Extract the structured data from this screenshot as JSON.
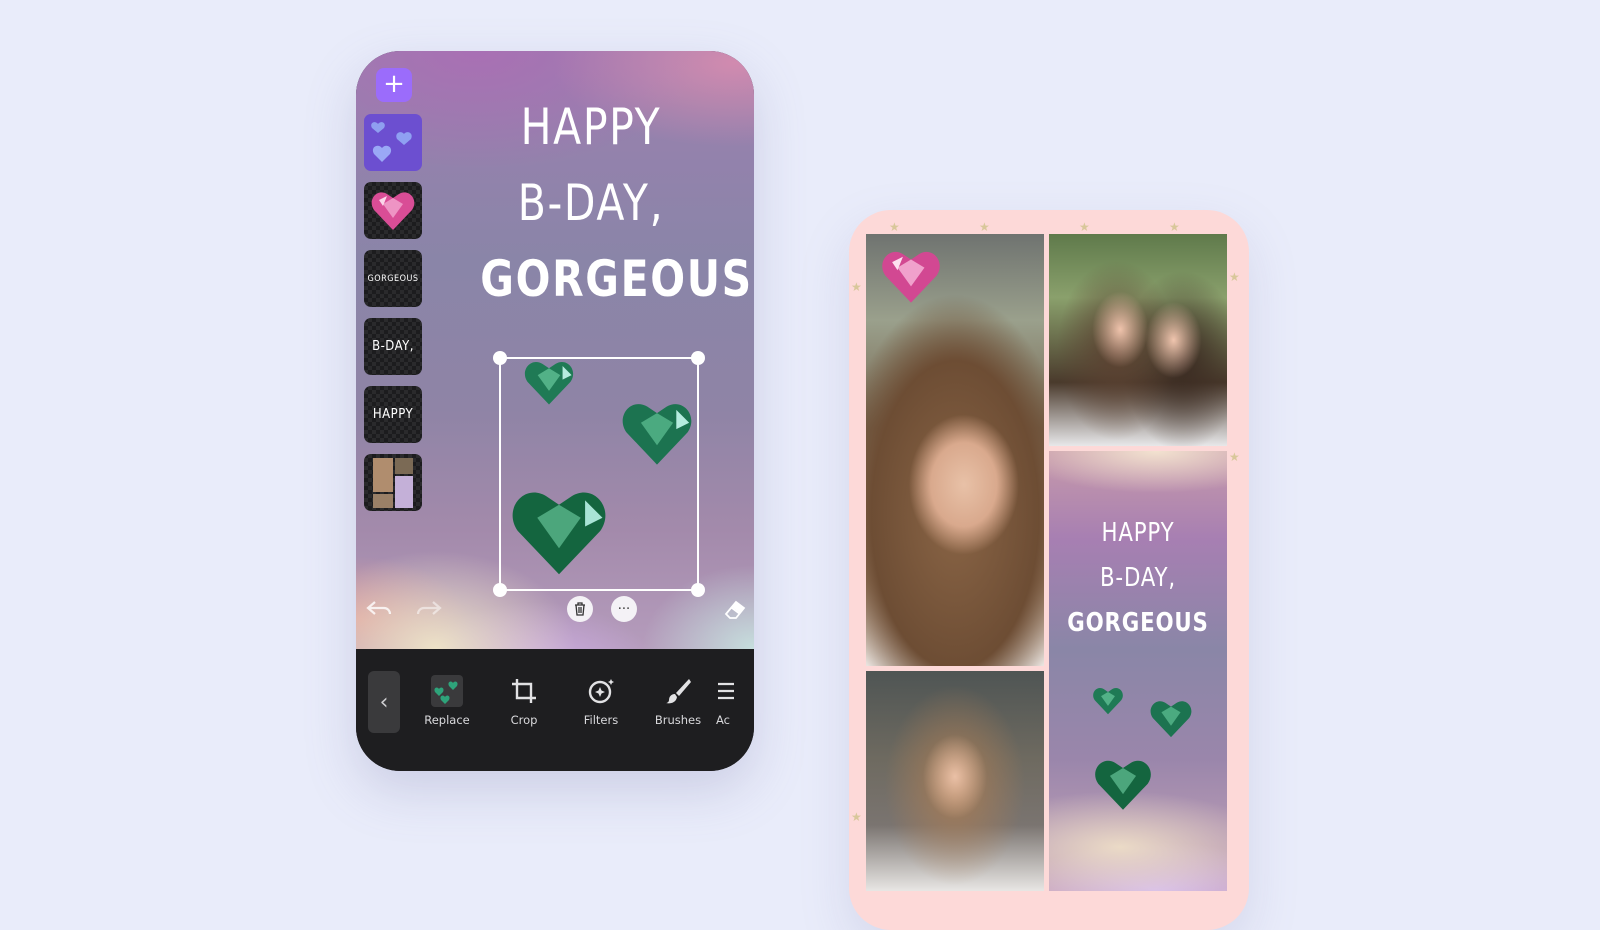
{
  "editor": {
    "add_layer_icon": "plus-icon",
    "layers": [
      {
        "type": "sticker",
        "label": "",
        "icon": "blue-hearts-sticker"
      },
      {
        "type": "sticker",
        "label": "",
        "icon": "pink-heart-gem"
      },
      {
        "type": "text",
        "label": "GORGEOUS"
      },
      {
        "type": "text",
        "label": "B-DAY,"
      },
      {
        "type": "text",
        "label": "HAPPY"
      },
      {
        "type": "image",
        "label": "",
        "icon": "collage-thumbnail"
      }
    ],
    "canvas_title": [
      "HAPPY",
      "B-DAY,",
      "GORGEOUS"
    ],
    "selection_controls": {
      "delete_icon": "trash-icon",
      "more_icon": "more-dots-icon",
      "more_label": "···"
    },
    "history": {
      "undo_icon": "undo-icon",
      "redo_icon": "redo-icon",
      "eraser_icon": "eraser-icon"
    },
    "toolbar": {
      "back_icon": "chevron-left-icon",
      "back_label": "‹",
      "tools": [
        {
          "label": "Replace",
          "icon": "replace-thumbnail"
        },
        {
          "label": "Crop",
          "icon": "crop-icon"
        },
        {
          "label": "Filters",
          "icon": "filters-icon"
        },
        {
          "label": "Brushes",
          "icon": "brush-icon"
        },
        {
          "label": "Ac",
          "icon": "adjust-icon"
        }
      ]
    },
    "colors": {
      "accent": "#9b6cfb",
      "toolbar_bg": "#1e1e20",
      "page_bg": "#e9ecfa"
    }
  },
  "collage": {
    "card_title": [
      "HAPPY",
      "B-DAY,",
      "GORGEOUS"
    ],
    "frame_color": "#fdd9d8"
  }
}
